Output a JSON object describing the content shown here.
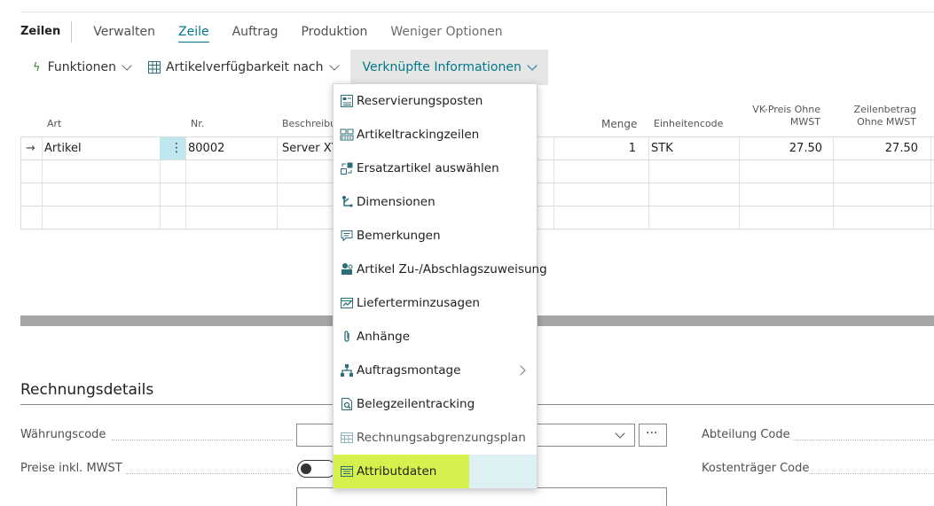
{
  "tabs": {
    "section": "Zeilen",
    "items": [
      "Verwalten",
      "Zeile",
      "Auftrag",
      "Produktion",
      "Weniger Optionen"
    ]
  },
  "actions": {
    "funktionen": "Funktionen",
    "artikelverf": "Artikelverfügbarkeit nach",
    "verknuepft": "Verknüpfte Informationen"
  },
  "grid": {
    "headers": {
      "art": "Art",
      "nr": "Nr.",
      "beschreibung": "Beschreibu",
      "menge": "Menge",
      "einheitencode": "Einheitencode",
      "vkpreis_1": "VK-Preis Ohne",
      "vkpreis_2": "MWST",
      "zeilenbetrag_1": "Zeilenbetrag",
      "zeilenbetrag_2": "Ohne MWST"
    },
    "row1": {
      "arrow": "→",
      "art": "Artikel",
      "nr": "80002",
      "beschreibung": "Server XY",
      "menge": "1",
      "einheit": "STK",
      "vkpreis": "27.50",
      "zeilenbetrag": "27.50"
    }
  },
  "section": {
    "title": "Rechnungsdetails",
    "fields": {
      "waehrungscode": "Währungscode",
      "preise_inkl": "Preise inkl. MWST",
      "abteilung": "Abteilung Code",
      "kostentraeger": "Kostenträger Code"
    },
    "ellipsis": "···"
  },
  "menu": {
    "items": [
      {
        "label": "Reservierungsposten",
        "icon": "ledger-icon"
      },
      {
        "label": "Artikeltrackingzeilen",
        "icon": "tracking-icon"
      },
      {
        "label": "Ersatzartikel auswählen",
        "icon": "substitute-icon"
      },
      {
        "label": "Dimensionen",
        "icon": "dimensions-icon"
      },
      {
        "label": "Bemerkungen",
        "icon": "comment-icon"
      },
      {
        "label": "Artikel Zu-/Abschlagszuweisung",
        "icon": "charge-icon"
      },
      {
        "label": "Lieferterminzusagen",
        "icon": "calendar-promise-icon"
      },
      {
        "label": "Anhänge",
        "icon": "paperclip-icon"
      },
      {
        "label": "Auftragsmontage",
        "icon": "hierarchy-icon"
      },
      {
        "label": "Belegzeilentracking",
        "icon": "document-search-icon"
      },
      {
        "label": "Rechnungsabgrenzungsplan",
        "icon": "schedule-icon"
      },
      {
        "label": "Attributdaten",
        "icon": "attribute-icon"
      }
    ]
  },
  "colors": {
    "accent": "#00788a",
    "highlight": "#d8f04d",
    "hover": "#ddf0f3"
  }
}
